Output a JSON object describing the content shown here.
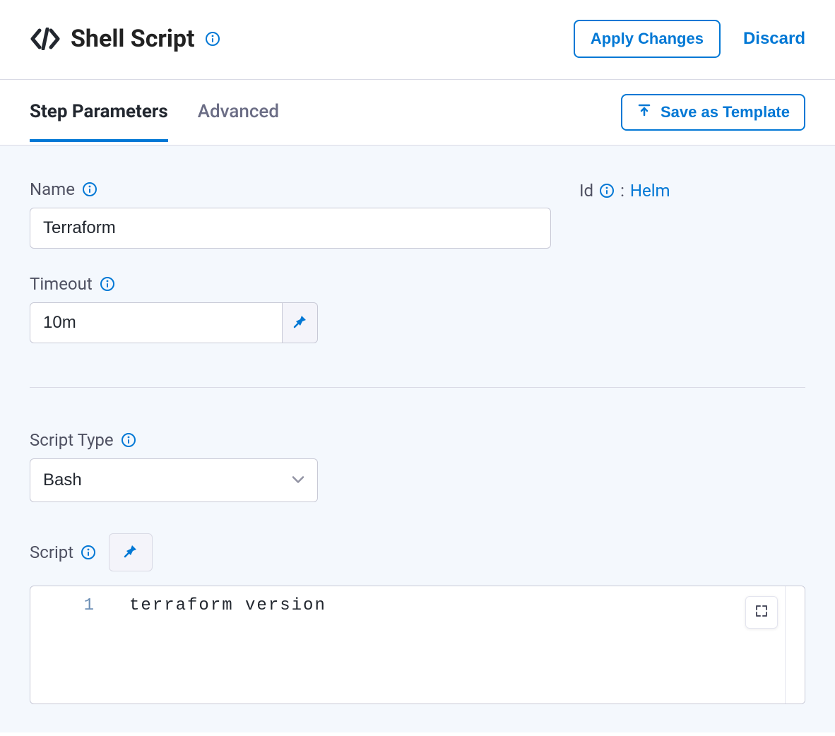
{
  "header": {
    "title": "Shell Script",
    "apply_label": "Apply Changes",
    "discard_label": "Discard"
  },
  "tabs": {
    "step_parameters": "Step Parameters",
    "advanced": "Advanced",
    "save_template": "Save as Template"
  },
  "form": {
    "name_label": "Name",
    "name_value": "Terraform",
    "id_label": "Id",
    "id_separator": ":",
    "id_value": "Helm",
    "timeout_label": "Timeout",
    "timeout_value": "10m",
    "script_type_label": "Script Type",
    "script_type_value": "Bash",
    "script_label": "Script",
    "script_line_number": "1",
    "script_content": "terraform version"
  },
  "colors": {
    "accent": "#0278d5",
    "panel_bg": "#f4f8fd"
  }
}
